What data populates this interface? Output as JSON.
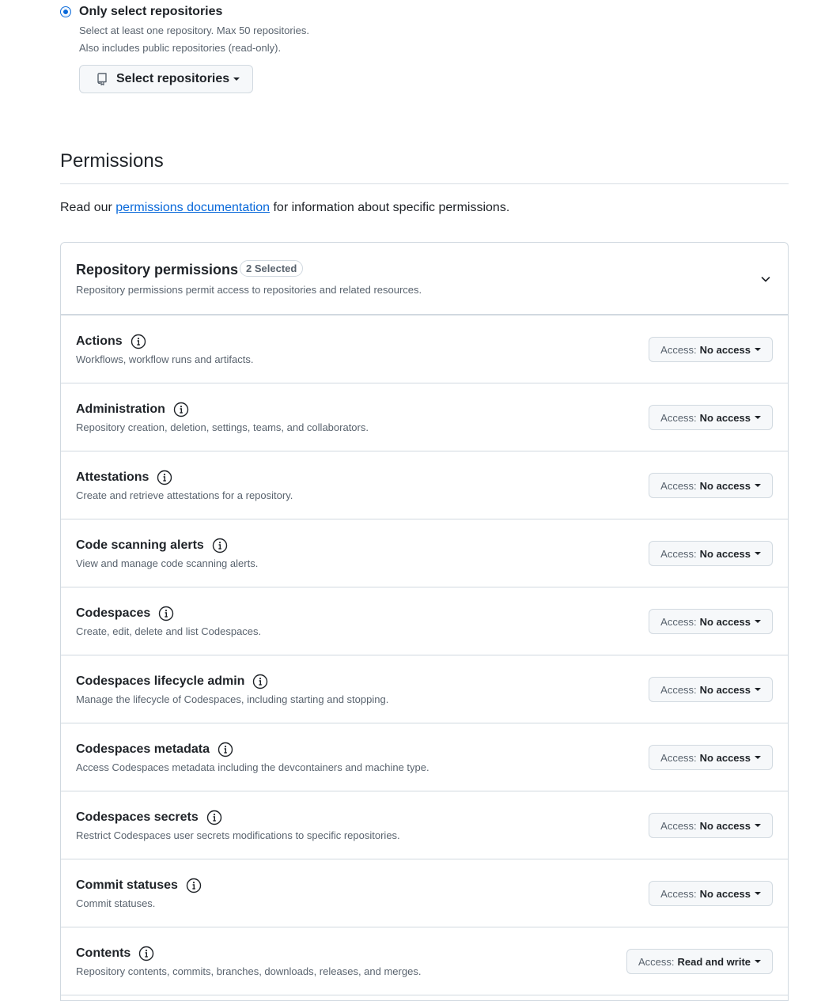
{
  "repo_select": {
    "option_label": "Only select repositories",
    "desc_line1": "Select at least one repository. Max 50 repositories.",
    "desc_line2": "Also includes public repositories (read-only).",
    "button_label": "Select repositories",
    "button_icon": "repo-icon"
  },
  "permissions": {
    "heading": "Permissions",
    "intro_before": "Read our ",
    "intro_link": "permissions documentation",
    "intro_after": " for information about specific permissions."
  },
  "repository_permissions": {
    "title": "Repository permissions",
    "badge": "2 Selected",
    "description": "Repository permissions permit access to repositories and related resources.",
    "access_label": "Access:",
    "items": [
      {
        "name": "Actions",
        "description": "Workflows, workflow runs and artifacts.",
        "access": "No access"
      },
      {
        "name": "Administration",
        "description": "Repository creation, deletion, settings, teams, and collaborators.",
        "access": "No access"
      },
      {
        "name": "Attestations",
        "description": "Create and retrieve attestations for a repository.",
        "access": "No access"
      },
      {
        "name": "Code scanning alerts",
        "description": "View and manage code scanning alerts.",
        "access": "No access"
      },
      {
        "name": "Codespaces",
        "description": "Create, edit, delete and list Codespaces.",
        "access": "No access"
      },
      {
        "name": "Codespaces lifecycle admin",
        "description": "Manage the lifecycle of Codespaces, including starting and stopping.",
        "access": "No access"
      },
      {
        "name": "Codespaces metadata",
        "description": "Access Codespaces metadata including the devcontainers and machine type.",
        "access": "No access"
      },
      {
        "name": "Codespaces secrets",
        "description": "Restrict Codespaces user secrets modifications to specific repositories.",
        "access": "No access"
      },
      {
        "name": "Commit statuses",
        "description": "Commit statuses.",
        "access": "No access"
      },
      {
        "name": "Contents",
        "description": "Repository contents, commits, branches, downloads, releases, and merges.",
        "access": "Read and write"
      }
    ]
  },
  "colors": {
    "accent": "#0969da",
    "border": "#d1d9e0",
    "muted_text": "#59636e",
    "button_bg": "#f6f8fa"
  }
}
